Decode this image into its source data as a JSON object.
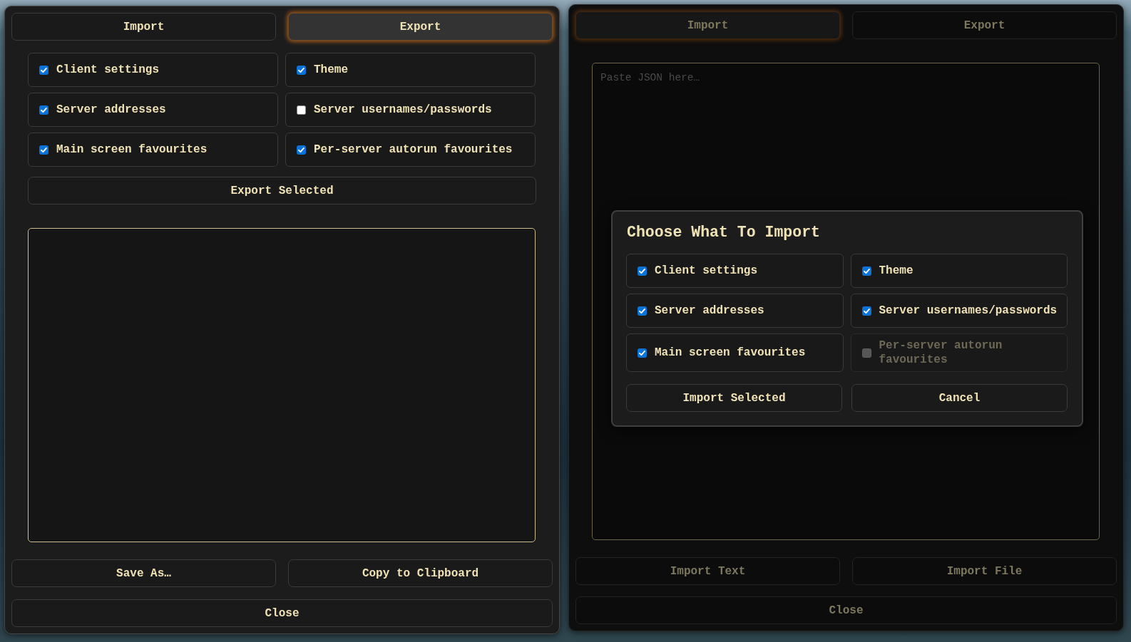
{
  "export_panel": {
    "tabs": [
      {
        "label": "Import",
        "selected": false
      },
      {
        "label": "Export",
        "selected": true
      }
    ],
    "options": [
      {
        "label": "Client settings",
        "checked": true
      },
      {
        "label": "Theme",
        "checked": true
      },
      {
        "label": "Server addresses",
        "checked": true
      },
      {
        "label": "Server usernames/passwords",
        "checked": false
      },
      {
        "label": "Main screen favourites",
        "checked": true
      },
      {
        "label": "Per-server autorun favourites",
        "checked": true
      }
    ],
    "export_button": "Export Selected",
    "actions": [
      "Save As…",
      "Copy to Clipboard"
    ],
    "close_button": "Close"
  },
  "import_panel": {
    "tabs": [
      {
        "label": "Import",
        "selected": true
      },
      {
        "label": "Export",
        "selected": false
      }
    ],
    "json_input": {
      "placeholder": "Paste JSON here…"
    },
    "actions": [
      "Import Text",
      "Import File"
    ],
    "close_button": "Close",
    "dialog": {
      "title": "Choose What To Import",
      "options": [
        {
          "label": "Client settings",
          "checked": true,
          "disabled": false
        },
        {
          "label": "Theme",
          "checked": true,
          "disabled": false
        },
        {
          "label": "Server addresses",
          "checked": true,
          "disabled": false
        },
        {
          "label": "Server usernames/passwords",
          "checked": true,
          "disabled": false
        },
        {
          "label": "Main screen favourites",
          "checked": true,
          "disabled": false
        },
        {
          "label": "Per-server autorun favourites",
          "checked": false,
          "disabled": true
        }
      ],
      "buttons": [
        "Import Selected",
        "Cancel"
      ]
    }
  }
}
